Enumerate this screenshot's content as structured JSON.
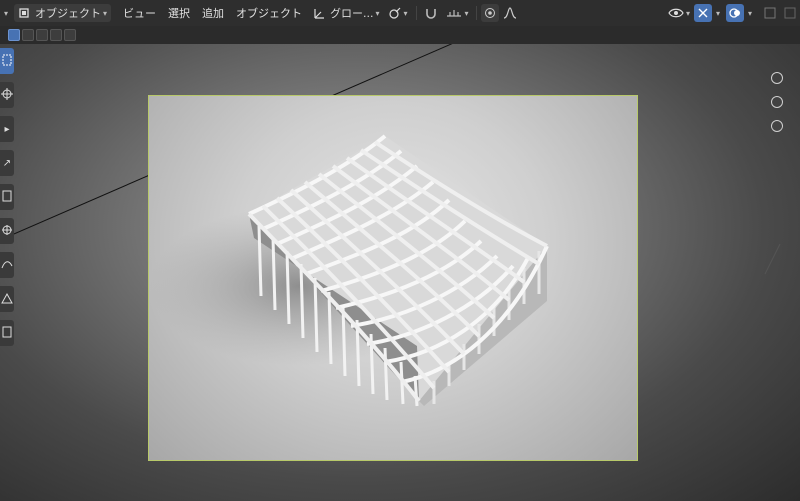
{
  "header": {
    "mode_label": "オブジェクト",
    "menus": [
      "ビュー",
      "選択",
      "追加",
      "オブジェクト"
    ],
    "transform_orientation": "グロー...",
    "icons": [
      "object-mode-icon",
      "transform-pivot-icon",
      "snap-icon",
      "proportional-edit-icon",
      "falloff-icon",
      "visibility-icon",
      "gizmo-icon",
      "overlay-icon",
      "shading-solid-icon"
    ]
  },
  "subbar": {
    "selection_modes": [
      "select-new",
      "select-extend",
      "select-subtract",
      "select-invert",
      "select-intersect"
    ]
  },
  "toolbar": {
    "tools": [
      "select-box",
      "cursor",
      "move",
      "rotate",
      "scale",
      "transform",
      "annotate",
      "measure",
      "add-cube"
    ]
  },
  "colors": {
    "accent": "#4772b3",
    "camera_frame": "#b8c96a"
  }
}
